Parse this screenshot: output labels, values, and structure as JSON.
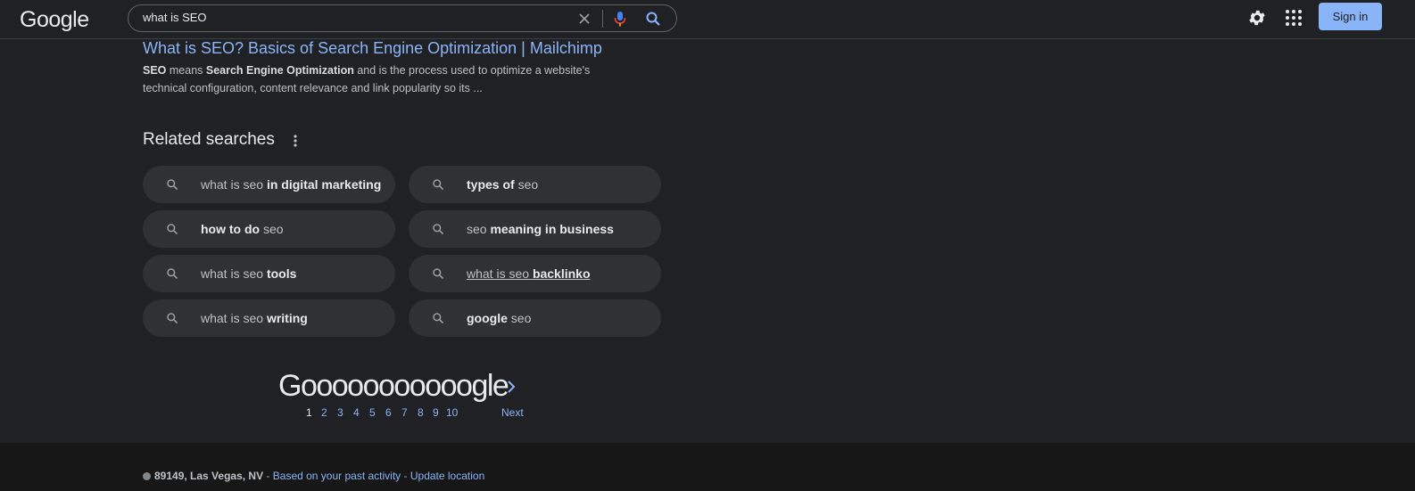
{
  "header": {
    "logo": "Google",
    "search": {
      "value": "what is SEO"
    },
    "signin_label": "Sign in"
  },
  "result": {
    "title": "What is SEO? Basics of Search Engine Optimization | Mailchimp",
    "snippet": [
      {
        "text": "SEO",
        "bold": true
      },
      {
        "text": " means ",
        "bold": false
      },
      {
        "text": "Search Engine Optimization",
        "bold": true
      },
      {
        "text": " and is the process used to optimize a website's technical configuration, content relevance and link popularity so its ...",
        "bold": false
      }
    ]
  },
  "related": {
    "heading": "Related searches",
    "chips": [
      {
        "parts": [
          {
            "t": "what is seo ",
            "b": false
          },
          {
            "t": "in digital marketing",
            "b": true
          }
        ]
      },
      {
        "parts": [
          {
            "t": "types of",
            "b": true
          },
          {
            "t": " seo",
            "b": false
          }
        ]
      },
      {
        "parts": [
          {
            "t": "how to do",
            "b": true
          },
          {
            "t": " seo",
            "b": false
          }
        ]
      },
      {
        "parts": [
          {
            "t": "seo ",
            "b": false
          },
          {
            "t": "meaning in business",
            "b": true
          }
        ]
      },
      {
        "parts": [
          {
            "t": "what is seo ",
            "b": false
          },
          {
            "t": "tools",
            "b": true
          }
        ]
      },
      {
        "parts": [
          {
            "t": "what is seo ",
            "b": false
          },
          {
            "t": "backlinko",
            "b": true
          }
        ],
        "underline": true
      },
      {
        "parts": [
          {
            "t": "what is seo ",
            "b": false
          },
          {
            "t": "writing",
            "b": true
          }
        ]
      },
      {
        "parts": [
          {
            "t": "google",
            "b": true
          },
          {
            "t": " seo",
            "b": false
          }
        ]
      }
    ]
  },
  "pagination": {
    "logo": "Gooooooooooogle",
    "pages": [
      "1",
      "2",
      "3",
      "4",
      "5",
      "6",
      "7",
      "8",
      "9",
      "10"
    ],
    "current": "1",
    "next_label": "Next"
  },
  "footer": {
    "location": "89149, Las Vegas, NV",
    "sep1": " - ",
    "activity_link": "Based on your past activity",
    "sep2": " - ",
    "update_link": "Update location"
  },
  "colors": {
    "link": "#8ab4f8",
    "background": "#202124",
    "chip": "#303134",
    "footer": "#171717"
  },
  "icons": [
    "clear-icon",
    "mic-icon",
    "search-icon",
    "gear-icon",
    "apps-icon",
    "more-vert-icon",
    "chevron-right-icon"
  ]
}
